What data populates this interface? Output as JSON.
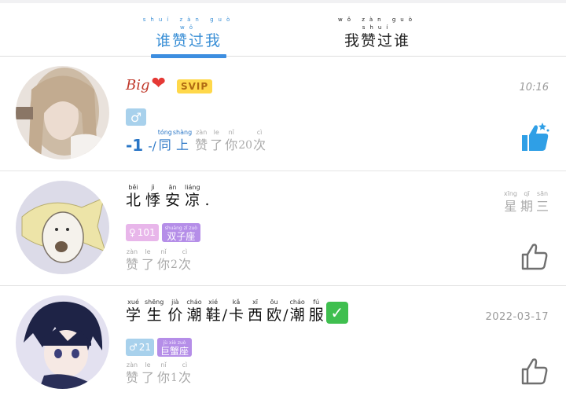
{
  "tabs": [
    {
      "pinyin": "shuí zàn guò wǒ",
      "label": "谁赞过我",
      "active": true
    },
    {
      "pinyin": "wǒ zàn guò shuí",
      "label": "我赞过谁",
      "active": false
    }
  ],
  "colors": {
    "accent": "#3d8ee0",
    "svip": "#ffd84a",
    "male_tag": "#a8d1ec",
    "female_tag": "#e8b6ea",
    "constellation_tag": "#b58ee8"
  },
  "items": [
    {
      "nickname": "Big",
      "nickname_emoji": "❤️",
      "vip_badge": "SVIP",
      "gender_icon": "♂",
      "tags": [],
      "like_count": "-1",
      "like_text_prefix": "-/",
      "like_words": [
        {
          "py": "tóng",
          "hz": "同"
        },
        {
          "py": "shàng",
          "hz": "上"
        },
        {
          "py": "zàn",
          "hz": "赞"
        },
        {
          "py": "le",
          "hz": "了"
        },
        {
          "py": "nǐ",
          "hz": "你"
        },
        {
          "py": "",
          "hz": "20"
        },
        {
          "py": "cì",
          "hz": "次"
        }
      ],
      "time": "10:16",
      "thumb_state": "active",
      "thumb_color": "#2f9fe6"
    },
    {
      "name_words": [
        {
          "py": "běi",
          "hz": "北"
        },
        {
          "py": "jì",
          "hz": "悸"
        },
        {
          "py": "ān",
          "hz": "安"
        },
        {
          "py": "liáng",
          "hz": "凉"
        },
        {
          "py": "",
          "hz": "."
        }
      ],
      "gender_icon": "♀",
      "age": "101",
      "constellation_py": "shuāng zǐ zuò",
      "constellation": "双子座",
      "like_words": [
        {
          "py": "zàn",
          "hz": "赞"
        },
        {
          "py": "le",
          "hz": "了"
        },
        {
          "py": "nǐ",
          "hz": "你"
        },
        {
          "py": "",
          "hz": "2"
        },
        {
          "py": "cì",
          "hz": "次"
        }
      ],
      "time_words": [
        {
          "py": "xīng",
          "hz": "星"
        },
        {
          "py": "qī",
          "hz": "期"
        },
        {
          "py": "sān",
          "hz": "三"
        }
      ],
      "thumb_state": "inactive",
      "thumb_color": "#7a7a7a"
    },
    {
      "name_words": [
        {
          "py": "xué",
          "hz": "学"
        },
        {
          "py": "shēng",
          "hz": "生"
        },
        {
          "py": "jià",
          "hz": "价"
        },
        {
          "py": "cháo",
          "hz": "潮"
        },
        {
          "py": "xié",
          "hz": "鞋"
        },
        {
          "py": "",
          "hz": "/"
        },
        {
          "py": "kǎ",
          "hz": "卡"
        },
        {
          "py": "xī",
          "hz": "西"
        },
        {
          "py": "ōu",
          "hz": "欧"
        },
        {
          "py": "",
          "hz": "/"
        },
        {
          "py": "cháo",
          "hz": "潮"
        },
        {
          "py": "fú",
          "hz": "服"
        }
      ],
      "name_emoji": "✅",
      "gender_icon": "♂",
      "age": "21",
      "constellation_py": "jù xiè zuò",
      "constellation": "巨蟹座",
      "like_words": [
        {
          "py": "zàn",
          "hz": "赞"
        },
        {
          "py": "le",
          "hz": "了"
        },
        {
          "py": "nǐ",
          "hz": "你"
        },
        {
          "py": "",
          "hz": "1"
        },
        {
          "py": "cì",
          "hz": "次"
        }
      ],
      "time": "2022-03-17",
      "thumb_state": "inactive",
      "thumb_color": "#7a7a7a"
    }
  ]
}
